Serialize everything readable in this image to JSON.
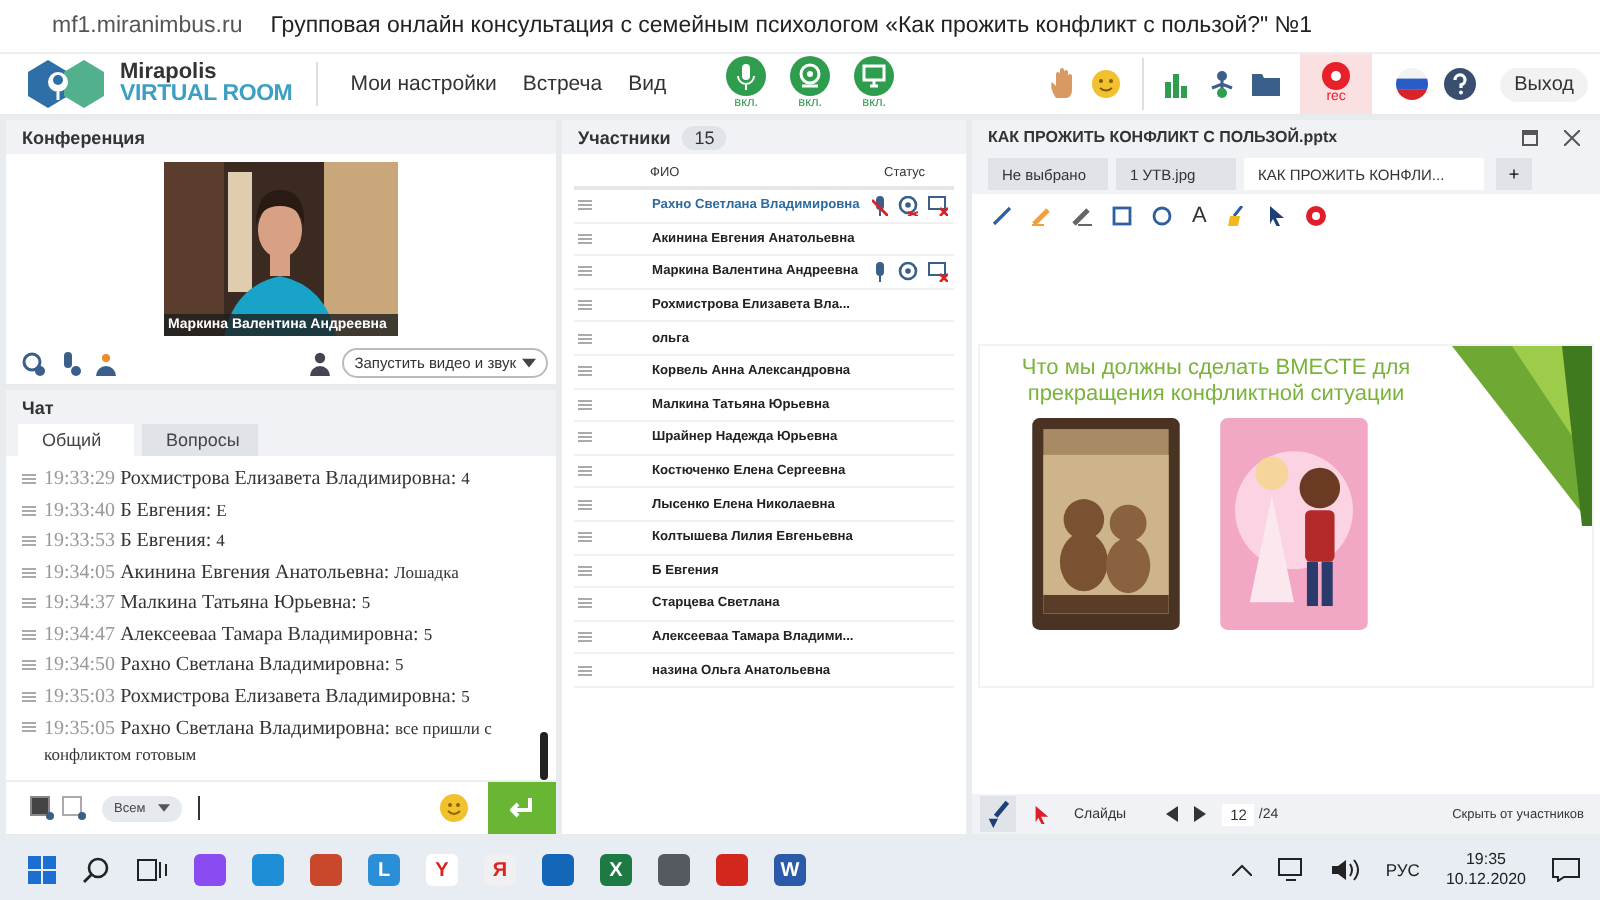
{
  "browser": {
    "url": "mf1.miranimbus.ru",
    "title": "Групповая онлайн консультация с семейным психологом «Как прожить конфликт с пользой?\" №1"
  },
  "app": {
    "logo_top": "Mirapolis",
    "logo_bottom": "VIRTUAL ROOM",
    "menu": [
      "Мои настройки",
      "Встреча",
      "Вид"
    ],
    "devices": [
      {
        "kind": "mic",
        "label": "вкл.",
        "on": true
      },
      {
        "kind": "camera",
        "label": "вкл.",
        "on": true
      },
      {
        "kind": "screen",
        "label": "вкл.",
        "on": true
      }
    ],
    "rec": "rec",
    "exit": "Выход"
  },
  "conference": {
    "title": "Конференция",
    "video_caption": "Маркина Валентина  Андреевна",
    "start_button": "Запустить видео и звук"
  },
  "chat": {
    "title": "Чат",
    "tabs": [
      {
        "label": "Общий",
        "selected": true
      },
      {
        "label": "Вопросы",
        "selected": false
      }
    ],
    "messages": [
      {
        "time": "19:33:29",
        "author": "Рохмистрова  Елизавета Владимировна:",
        "text": "4"
      },
      {
        "time": "19:33:40",
        "author": "Б  Евгения:",
        "text": "Е"
      },
      {
        "time": "19:33:53",
        "author": "Б  Евгения:",
        "text": "4"
      },
      {
        "time": "19:34:05",
        "author": "Акинина  Евгения Анатольевна:",
        "text": "Лошадка"
      },
      {
        "time": "19:34:37",
        "author": "Малкина Татьяна  Юрьевна:",
        "text": "5"
      },
      {
        "time": "19:34:47",
        "author": "Алексеевaa Тамара  Владимировна:",
        "text": "5"
      },
      {
        "time": "19:34:50",
        "author": "Рахно Светлана  Владимировна:",
        "text": "5"
      },
      {
        "time": "19:35:03",
        "author": "Рохмистрова  Елизавета Владимировна:",
        "text": "5"
      },
      {
        "time": "19:35:05",
        "author": "Рахно Светлана  Владимировна:",
        "text": "все пришли с конфликтом готовым"
      }
    ],
    "recipient": "Всем"
  },
  "participants": {
    "title": "Участники",
    "count": "15",
    "columns": [
      "ФИО",
      "Статус"
    ],
    "rows": [
      {
        "name": "Рахно Светлана  Владимировна",
        "highlighted": true,
        "mic_on": false,
        "camera_on": false,
        "screen_on": false
      },
      {
        "name": "Акинина  Евгения Анатольевна",
        "highlighted": false
      },
      {
        "name": "Маркина Валентина  Андреевна",
        "highlighted": false,
        "mic_on": true,
        "camera_on": true,
        "screen_on": false
      },
      {
        "name": "Рохмистрова  Елизавета Вла...",
        "highlighted": false
      },
      {
        "name": "ольга",
        "highlighted": false
      },
      {
        "name": "Корвель Анна  Александровна",
        "highlighted": false
      },
      {
        "name": "Малкина Татьяна  Юрьевна",
        "highlighted": false
      },
      {
        "name": "Шрайнер Надежда  Юрьевна",
        "highlighted": false
      },
      {
        "name": "Костюченко  Елена Сергеевна",
        "highlighted": false
      },
      {
        "name": "Лысенко  Елена  Николаевна",
        "highlighted": false
      },
      {
        "name": "Колтышева  Лилия Евгеньевна",
        "highlighted": false
      },
      {
        "name": "Б  Евгения",
        "highlighted": false
      },
      {
        "name": "Старцева  Светлана",
        "highlighted": false
      },
      {
        "name": "Алексеевaa Тамара  Владими...",
        "highlighted": false
      },
      {
        "name": "назина  Ольга Анатольевна",
        "highlighted": false
      }
    ]
  },
  "presentation": {
    "title": "КАК ПРОЖИТЬ КОНФЛИКТ С ПОЛЬЗОЙ.pptx",
    "tabs": [
      {
        "label": "Не выбрано",
        "selected": false
      },
      {
        "label": "1 УТВ.jpg",
        "selected": false
      },
      {
        "label": "КАК ПРОЖИТЬ КОНФЛИ...",
        "selected": true
      }
    ],
    "add_tab": "+",
    "text_tool": "A",
    "slide_title": "Что мы должны сделать ВМЕСТЕ для прекращения конфликтной ситуации",
    "slides_label": "Слайды",
    "page": "12",
    "total": "/24",
    "hide": "Скрыть от участников"
  },
  "taskbar": {
    "apps": [
      {
        "color": "#8a4cf0"
      },
      {
        "color": "#1e8fd6"
      },
      {
        "color": "#c9482c"
      },
      {
        "color": "#2b8fd8",
        "glyph": "L"
      },
      {
        "color": "#ffffff",
        "glyph": "Y"
      },
      {
        "color": "#f0f0f0",
        "glyph": "Я"
      },
      {
        "color": "#1466b8"
      },
      {
        "color": "#1d7a42",
        "glyph": "X"
      },
      {
        "color": "#555a60"
      },
      {
        "color": "#d3261d"
      },
      {
        "color": "#2a5aa8",
        "glyph": "W"
      }
    ],
    "lang": "РУС",
    "time": "19:35",
    "date": "10.12.2020"
  }
}
